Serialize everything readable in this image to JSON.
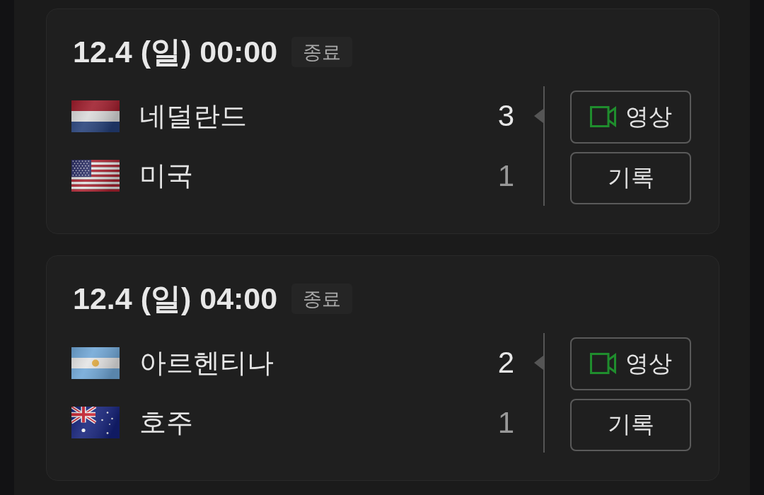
{
  "matches": [
    {
      "datetime": "12.4 (일) 00:00",
      "status": "종료",
      "teams": [
        {
          "kind": "netherlands",
          "name": "네덜란드",
          "score": "3",
          "winner": true
        },
        {
          "kind": "usa",
          "name": "미국",
          "score": "1",
          "winner": false
        }
      ],
      "buttons": [
        {
          "kind": "video",
          "label": "영상"
        },
        {
          "kind": "record",
          "label": "기록"
        }
      ]
    },
    {
      "datetime": "12.4 (일) 04:00",
      "status": "종료",
      "teams": [
        {
          "kind": "argentina",
          "name": "아르헨티나",
          "score": "2",
          "winner": true
        },
        {
          "kind": "australia",
          "name": "호주",
          "score": "1",
          "winner": false
        }
      ],
      "buttons": [
        {
          "kind": "video",
          "label": "영상"
        },
        {
          "kind": "record",
          "label": "기록"
        }
      ]
    }
  ]
}
